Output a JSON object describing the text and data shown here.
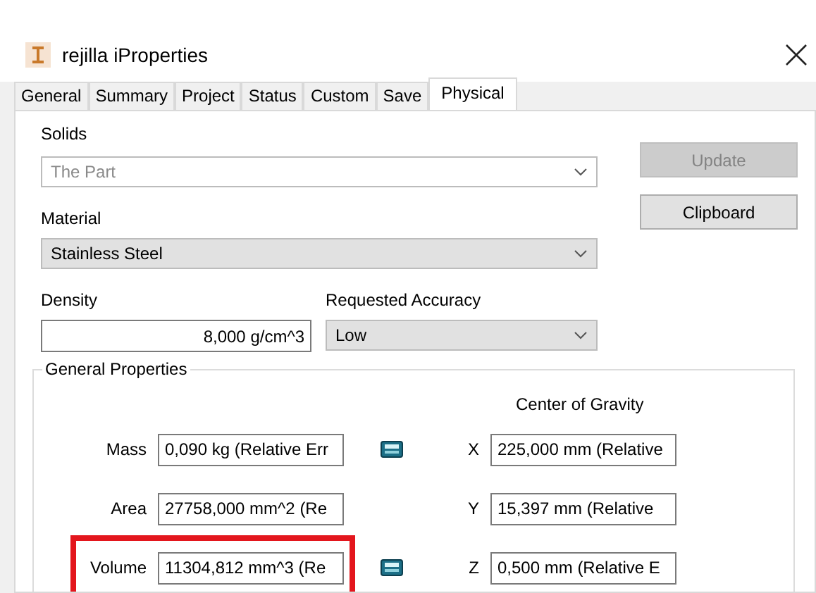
{
  "window": {
    "title": "rejilla iProperties"
  },
  "tabs": [
    {
      "label": "General",
      "selected": false
    },
    {
      "label": "Summary",
      "selected": false
    },
    {
      "label": "Project",
      "selected": false
    },
    {
      "label": "Status",
      "selected": false
    },
    {
      "label": "Custom",
      "selected": false
    },
    {
      "label": "Save",
      "selected": false
    },
    {
      "label": "Physical",
      "selected": true
    }
  ],
  "solids": {
    "label": "Solids",
    "value": "The Part",
    "disabled": true
  },
  "buttons": [
    {
      "label": "Update",
      "disabled": true
    },
    {
      "label": "Clipboard",
      "disabled": false
    }
  ],
  "material": {
    "label": "Material",
    "value": "Stainless Steel"
  },
  "density": {
    "label": "Density",
    "value": "8,000 g/cm^3"
  },
  "accuracy": {
    "label": "Requested Accuracy",
    "value": "Low"
  },
  "general_properties": {
    "title": "General Properties",
    "center_of_gravity_title": "Center of Gravity",
    "rows": [
      {
        "label": "Mass",
        "value": "0,090 kg (Relative Err",
        "calculator": true,
        "highlighted": false,
        "axis": "X",
        "axis_value": "225,000 mm (Relative"
      },
      {
        "label": "Area",
        "value": "27758,000 mm^2 (Re",
        "calculator": false,
        "highlighted": false,
        "axis": "Y",
        "axis_value": "15,397 mm (Relative"
      },
      {
        "label": "Volume",
        "value": "11304,812 mm^3 (Re",
        "calculator": true,
        "highlighted": true,
        "axis": "Z",
        "axis_value": "0,500 mm (Relative E"
      }
    ]
  }
}
